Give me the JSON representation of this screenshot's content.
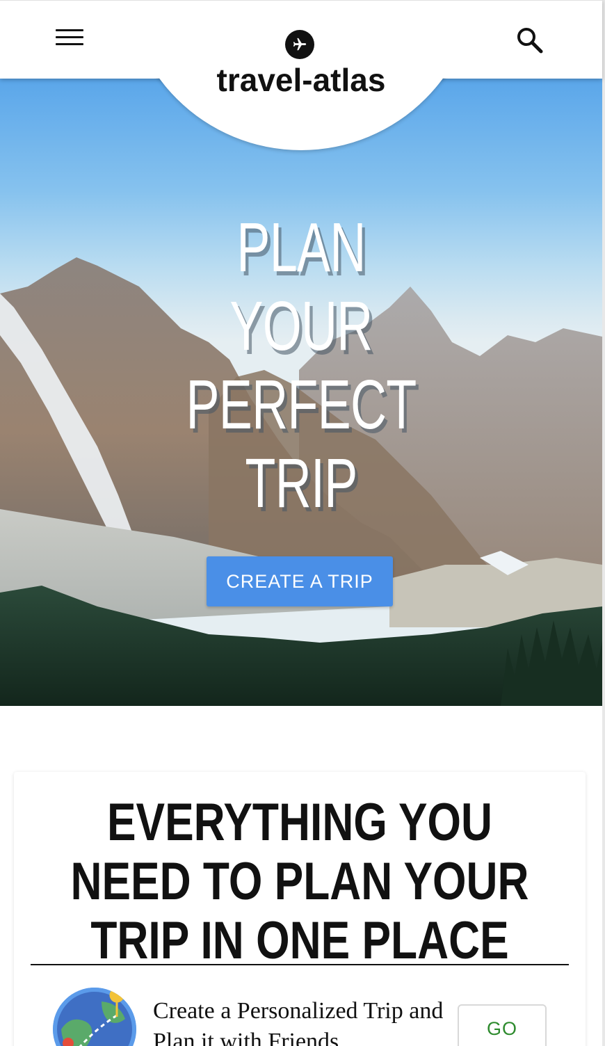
{
  "header": {
    "logo_text": "travel-atlas",
    "logo_icon": "airplane-icon",
    "menu_icon": "hamburger-menu-icon",
    "search_icon": "search-icon"
  },
  "hero": {
    "title_lines": [
      "PLAN",
      "YOUR",
      "PERFECT",
      "TRIP"
    ],
    "cta_label": "CREATE A TRIP",
    "cta_color": "#4a8fe7"
  },
  "features": {
    "heading": "EVERYTHING YOU NEED TO PLAN YOUR TRIP IN ONE PLACE",
    "items": [
      {
        "icon": "map-route-icon",
        "text": "Create a Personalized Trip and Plan it with Friends",
        "button_label": "GO",
        "button_color": "#2e8b2e"
      }
    ]
  }
}
